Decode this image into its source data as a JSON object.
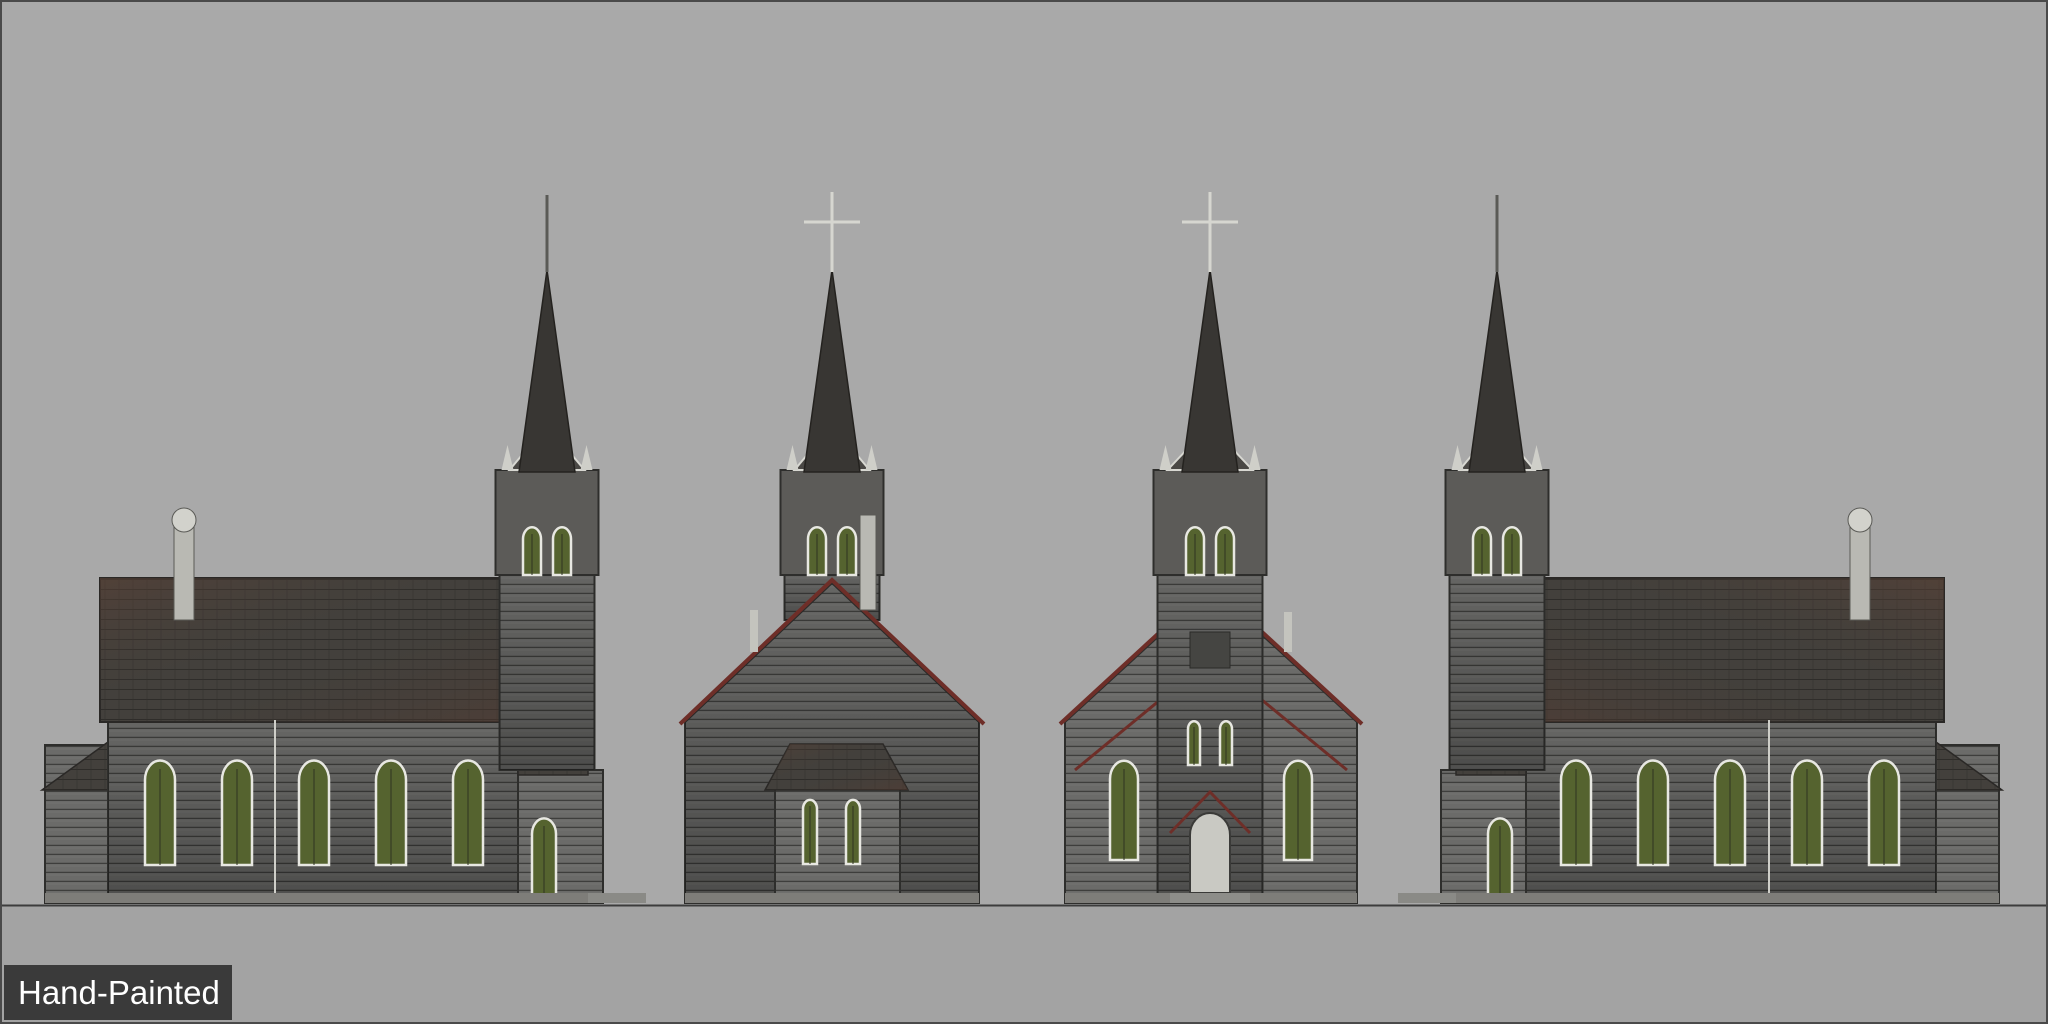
{
  "caption": {
    "text": "Hand-Painted"
  },
  "colors": {
    "background": "#a9a9a9",
    "ground": "#a3a3a3",
    "horizon_line": "#3c3c3c",
    "wall": "#6a6a68",
    "wall_dark": "#4d4d4b",
    "roof": "#3f3d3a",
    "roof_rust": "#5a3f33",
    "spire": "#383633",
    "window_glass": "#55632f",
    "trim_red": "#6e2e28",
    "label_bg": "#3a3a3a",
    "label_text": "#ffffff"
  },
  "views": [
    {
      "name": "side-view-left",
      "kind": "side",
      "tower_side": "right",
      "windows": 5
    },
    {
      "name": "back-view",
      "kind": "back"
    },
    {
      "name": "front-view",
      "kind": "front"
    },
    {
      "name": "side-view-right",
      "kind": "side",
      "tower_side": "left",
      "windows": 5
    }
  ]
}
